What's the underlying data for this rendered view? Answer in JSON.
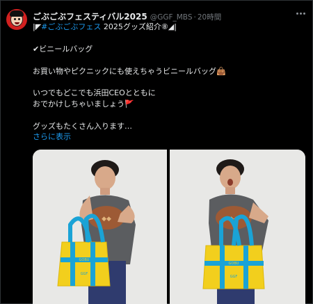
{
  "tweet": {
    "display_name": "ごぶごぶフェスティバル2025",
    "handle": "@GGF_MBS",
    "dot": "·",
    "time": "20時間",
    "line1_prefix": "|◤",
    "hashtag": "#ごぶごぶフェス",
    "line1_suffix": " 2025グッズ紹介⑧◢|",
    "line2": "✔ビニールバッグ",
    "line3": "お買い物やピクニックにも使えちゃうビニールバッグ👜",
    "line4": "いつでもどこでも浜田CEOとともに",
    "line5": "おでかけしちゃいましょう🚩",
    "line6": "グッズもたくさん入ります…",
    "read_more": "さらに表示"
  },
  "icons": {
    "avatar": "profile-avatar-icon",
    "more": "more-options-icon"
  },
  "colors": {
    "background": "#000000",
    "text": "#e7e9ea",
    "secondary": "#71767b",
    "link": "#1d9bf0",
    "bag": "#f2cf1d",
    "strap": "#1aa3d6"
  }
}
